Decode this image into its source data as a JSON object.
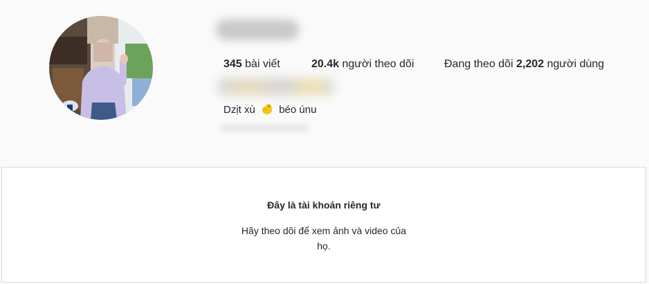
{
  "profile": {
    "stats": {
      "posts_count": "345",
      "posts_label": "bài viết",
      "followers_count": "20.4k",
      "followers_label": "người theo dõi",
      "following_prefix": "Đang theo dõi",
      "following_count": "2,202",
      "following_label": "người dùng"
    },
    "bio": {
      "text_before": "Dzịt xù",
      "emoji": "duck-emoji",
      "text_after": "béo únu"
    }
  },
  "private_notice": {
    "title": "Đây là tài khoản riêng tư",
    "description": "Hãy theo dõi để xem ảnh và video của họ."
  },
  "colors": {
    "background": "#fafafa",
    "panel": "#ffffff",
    "border": "#dbdbdb",
    "text": "#262626"
  }
}
